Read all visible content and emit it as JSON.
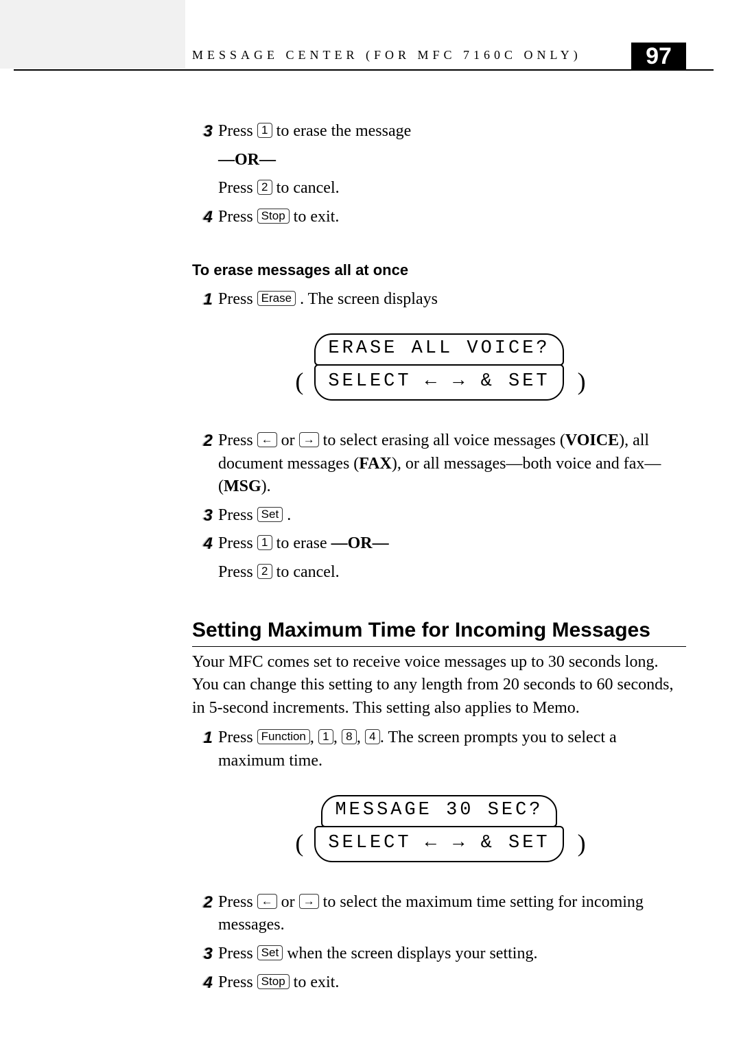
{
  "header": {
    "running_title": "MESSAGE CENTER (FOR MFC 7160C ONLY)",
    "page_number": "97"
  },
  "keys": {
    "k1": "1",
    "k2": "2",
    "k4": "4",
    "k8": "8",
    "stop": "Stop",
    "erase": "Erase",
    "set": "Set",
    "func": "Function",
    "left": "←",
    "right": "→"
  },
  "sectionA": {
    "s3_a": "Press ",
    "s3_b": " to erase the message",
    "or_line": "—OR—",
    "s3_c": "Press ",
    "s3_d": " to cancel.",
    "s4_a": "Press ",
    "s4_b": "  to exit."
  },
  "sectionB": {
    "heading": "To erase messages all at once",
    "s1_a": "Press ",
    "s1_b": ".  The screen displays",
    "lcd_line1": "ERASE ALL VOICE?",
    "lcd_line2": "SELECT ← → & SET",
    "s2_a": "Press ",
    "s2_b": " or ",
    "s2_c": " to select erasing all voice messages (",
    "s2_voice": "VOICE",
    "s2_d": "), all document messages (",
    "s2_fax": "FAX",
    "s2_e": "), or all messages—both voice and fax—(",
    "s2_msg": "MSG",
    "s2_f": ").",
    "s3_a": "Press ",
    "s3_b": ".",
    "s4_a": "Press ",
    "s4_b": " to erase ",
    "s4_or": "—OR—",
    "s4_c": "Press ",
    "s4_d": " to cancel."
  },
  "sectionC": {
    "heading": "Setting Maximum Time for Incoming Messages",
    "intro": "Your MFC comes set to receive voice messages up to 30 seconds long. You can change this setting to any length from 20 seconds to 60 seconds, in 5-second increments. This setting also applies to Memo.",
    "s1_a": "Press ",
    "s1_b": ", ",
    "s1_c": ", ",
    "s1_d": ", ",
    "s1_e": ". The screen prompts you to select a maximum time.",
    "lcd_line1": "MESSAGE 30 SEC?",
    "lcd_line2": "SELECT ← → & SET",
    "s2_a": "Press ",
    "s2_b": " or ",
    "s2_c": " to select the maximum time setting for incoming messages.",
    "s3_a": "Press ",
    "s3_b": " when the screen displays your setting.",
    "s4_a": "Press ",
    "s4_b": " to exit."
  }
}
